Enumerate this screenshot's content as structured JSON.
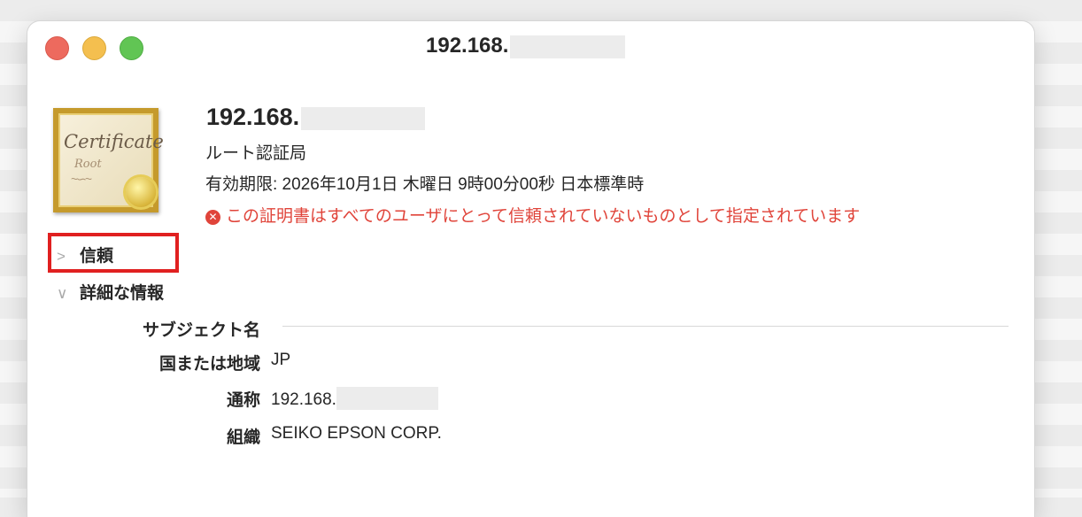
{
  "window": {
    "title": "192.168."
  },
  "certificate": {
    "icon_text": "Certificate",
    "icon_subtext": "Root",
    "name": "192.168.",
    "kind": "ルート認証局",
    "expiry": "有効期限: 2026年10月1日 木曜日 9時00分00秒 日本標準時",
    "warning": "この証明書はすべてのユーザにとって信頼されていないものとして指定されています",
    "warning_color": "#e0443a"
  },
  "sections": {
    "trust_label": "信頼",
    "details_label": "詳細な情報"
  },
  "subject": {
    "header": "サブジェクト名",
    "fields": [
      {
        "label": "国または地域",
        "value": "JP"
      },
      {
        "label": "通称",
        "value": "192.168."
      },
      {
        "label": "組織",
        "value": "SEIKO EPSON CORP."
      }
    ]
  }
}
